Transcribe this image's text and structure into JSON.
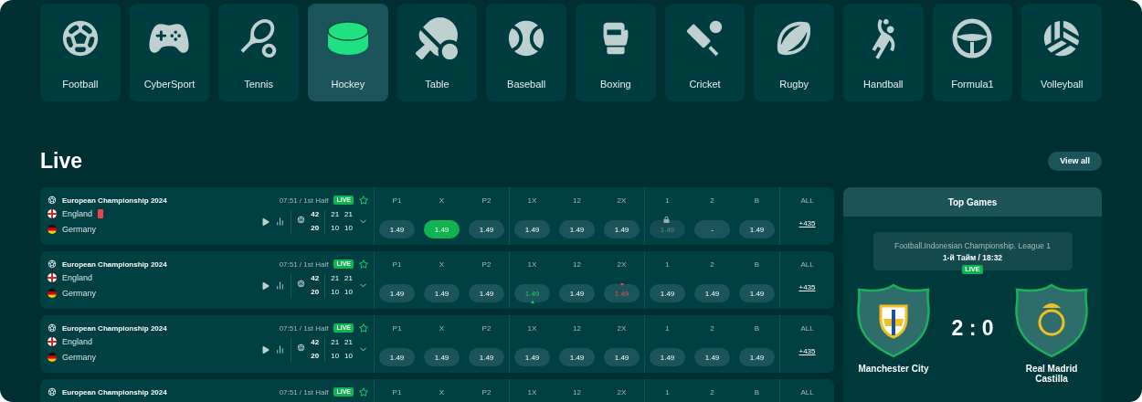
{
  "sports": [
    {
      "label": "Football",
      "selected": false
    },
    {
      "label": "CyberSport",
      "selected": false
    },
    {
      "label": "Tennis",
      "selected": false
    },
    {
      "label": "Hockey",
      "selected": true
    },
    {
      "label": "Table",
      "selected": false
    },
    {
      "label": "Baseball",
      "selected": false
    },
    {
      "label": "Boxing",
      "selected": false
    },
    {
      "label": "Cricket",
      "selected": false
    },
    {
      "label": "Rugby",
      "selected": false
    },
    {
      "label": "Handball",
      "selected": false
    },
    {
      "label": "Formula1",
      "selected": false
    },
    {
      "label": "Volleyball",
      "selected": false
    }
  ],
  "live": {
    "title": "Live",
    "view_all": "View all"
  },
  "matches": [
    {
      "league": "European Championship 2024",
      "time": "07:51 / 1st Half",
      "badge": "LIVE",
      "teams": [
        {
          "name": "England",
          "red_card": true
        },
        {
          "name": "Germany",
          "red_card": false
        }
      ],
      "scores": [
        {
          "total": "42",
          "periods": [
            "21",
            "21"
          ]
        },
        {
          "total": "20",
          "periods": [
            "10",
            "10"
          ]
        }
      ],
      "markets": [
        [
          "P1",
          "X",
          "P2"
        ],
        [
          "1X",
          "12",
          "2X"
        ],
        [
          "1",
          "2",
          "B"
        ]
      ],
      "all_label": "ALL",
      "odds": [
        [
          {
            "value": "1.49",
            "kind": "normal"
          },
          {
            "value": "1.49",
            "kind": "selected"
          },
          {
            "value": "1.49",
            "kind": "normal"
          }
        ],
        [
          {
            "value": "1.49",
            "kind": "normal"
          },
          {
            "value": "1.49",
            "kind": "normal"
          },
          {
            "value": "1.49",
            "kind": "normal"
          }
        ],
        [
          {
            "value": "1.49",
            "kind": "locked"
          },
          {
            "value": "-",
            "kind": "normal"
          },
          {
            "value": "1.49",
            "kind": "normal"
          }
        ]
      ],
      "more": "+435"
    },
    {
      "league": "European Championship 2024",
      "time": "07:51 / 1st Half",
      "badge": "LIVE",
      "teams": [
        {
          "name": "England",
          "red_card": false
        },
        {
          "name": "Germany",
          "red_card": false
        }
      ],
      "scores": [
        {
          "total": "42",
          "periods": [
            "21",
            "21"
          ]
        },
        {
          "total": "20",
          "periods": [
            "10",
            "10"
          ]
        }
      ],
      "markets": [
        [
          "P1",
          "X",
          "P2"
        ],
        [
          "1X",
          "12",
          "2X"
        ],
        [
          "1",
          "2",
          "B"
        ]
      ],
      "all_label": "ALL",
      "odds": [
        [
          {
            "value": "1.49",
            "kind": "normal"
          },
          {
            "value": "1.49",
            "kind": "normal"
          },
          {
            "value": "1.49",
            "kind": "normal"
          }
        ],
        [
          {
            "value": "1.49",
            "kind": "up"
          },
          {
            "value": "1.49",
            "kind": "normal"
          },
          {
            "value": "1.49",
            "kind": "down"
          }
        ],
        [
          {
            "value": "1.49",
            "kind": "normal"
          },
          {
            "value": "1.49",
            "kind": "normal"
          },
          {
            "value": "1.49",
            "kind": "normal"
          }
        ]
      ],
      "more": "+435"
    },
    {
      "league": "European Championship 2024",
      "time": "07:51 / 1st Half",
      "badge": "LIVE",
      "teams": [
        {
          "name": "England",
          "red_card": false
        },
        {
          "name": "Germany",
          "red_card": false
        }
      ],
      "scores": [
        {
          "total": "42",
          "periods": [
            "21",
            "21"
          ]
        },
        {
          "total": "20",
          "periods": [
            "10",
            "10"
          ]
        }
      ],
      "markets": [
        [
          "P1",
          "X",
          "P2"
        ],
        [
          "1X",
          "12",
          "2X"
        ],
        [
          "1",
          "2",
          "B"
        ]
      ],
      "all_label": "ALL",
      "odds": [
        [
          {
            "value": "1.49",
            "kind": "normal"
          },
          {
            "value": "1.49",
            "kind": "normal"
          },
          {
            "value": "1.49",
            "kind": "normal"
          }
        ],
        [
          {
            "value": "1.49",
            "kind": "normal"
          },
          {
            "value": "1.49",
            "kind": "normal"
          },
          {
            "value": "1.49",
            "kind": "normal"
          }
        ],
        [
          {
            "value": "1.49",
            "kind": "normal"
          },
          {
            "value": "1.49",
            "kind": "normal"
          },
          {
            "value": "1.49",
            "kind": "normal"
          }
        ]
      ],
      "more": "+435"
    },
    {
      "league": "European Championship 2024",
      "time": "07:51 / 1st Half",
      "badge": "LIVE",
      "markets": [
        [
          "P1",
          "X",
          "P2"
        ],
        [
          "1X",
          "12",
          "2X"
        ],
        [
          "1",
          "2",
          "B"
        ]
      ],
      "all_label": "ALL"
    }
  ],
  "top_games": {
    "title": "Top Games",
    "league": "Football.Indonesian Championship. League 1",
    "period": "1-й Тайм / 18:32",
    "badge": "LIVE",
    "score": "2 : 0",
    "home": "Manchester City",
    "away": "Real Madrid Castilla"
  }
}
